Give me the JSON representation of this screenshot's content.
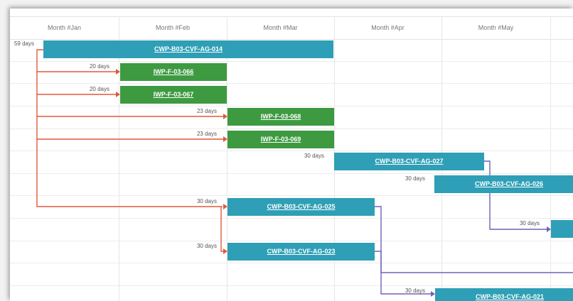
{
  "months": [
    "Month #Jan",
    "Month #Feb",
    "Month #Mar",
    "Month #Apr",
    "Month #May",
    ""
  ],
  "colors": {
    "blue_task": "#2e9fb6",
    "green_task": "#3d9a41",
    "link_red": "#e05a3a",
    "link_purple": "#6f62b8"
  },
  "tasks": [
    {
      "name": "CWP-B03-CVF-AG-014",
      "duration": "59 days"
    },
    {
      "name": "IWP-F-03-066",
      "duration": "20 days"
    },
    {
      "name": "IWP-F-03-067",
      "duration": "20 days"
    },
    {
      "name": "IWP-F-03-068",
      "duration": "23 days"
    },
    {
      "name": "IWP-F-03-069",
      "duration": "23 days"
    },
    {
      "name": "CWP-B03-CVF-AG-027",
      "duration": "30 days"
    },
    {
      "name": "CWP-B03-CVF-AG-026",
      "duration": "30 days"
    },
    {
      "name": "CWP-B03-CVF-AG-025",
      "duration": "30 days"
    },
    {
      "name": "",
      "duration": "30 days"
    },
    {
      "name": "CWP-B03-CVF-AG-023",
      "duration": "30 days"
    },
    {
      "name": "CWP-B03-CVF-AG-021",
      "duration": "30 days"
    }
  ]
}
